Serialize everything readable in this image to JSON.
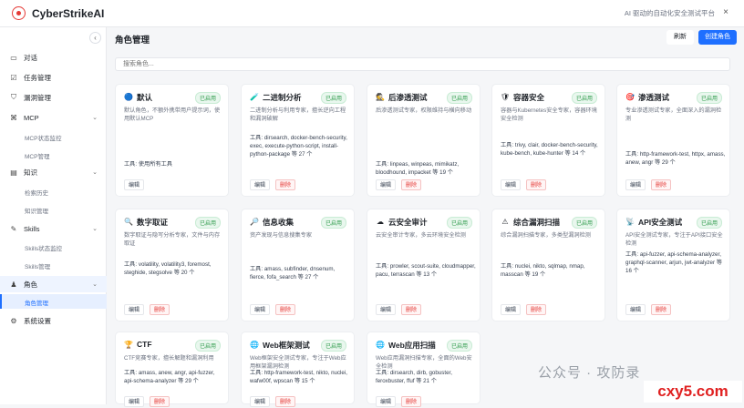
{
  "app": {
    "title": "CyberStrikeAI",
    "tagline": "AI 驱动的自动化安全测试平台",
    "close": "×"
  },
  "sidebar": {
    "items": [
      {
        "label": "对话",
        "icon": "chat-icon"
      },
      {
        "label": "任务管理",
        "icon": "task-icon"
      },
      {
        "label": "漏洞管理",
        "icon": "shield-icon"
      },
      {
        "label": "MCP",
        "icon": "mcp-icon",
        "subs": [
          "MCP状态监控",
          "MCP管理"
        ]
      },
      {
        "label": "知识",
        "icon": "knowledge-icon",
        "subs": [
          "检索历史",
          "知识管理"
        ]
      },
      {
        "label": "Skills",
        "icon": "skills-icon",
        "subs": [
          "Skills状态监控",
          "Skills管理"
        ]
      },
      {
        "label": "角色",
        "icon": "role-icon",
        "subs": [
          "角色管理"
        ]
      },
      {
        "label": "系统设置",
        "icon": "gear-icon"
      }
    ]
  },
  "main": {
    "title": "角色管理",
    "refresh": "刷新",
    "create": "创建角色",
    "search_placeholder": "搜索角色..."
  },
  "labels": {
    "enabled": "已启用",
    "edit": "编辑",
    "delete": "删除",
    "tools_prefix": "工具:"
  },
  "cards": [
    {
      "icon": "🔵",
      "title": "默认",
      "desc": "默认角色，不额外携带用户提示词，使用默认MCP",
      "tools": "使用所有工具",
      "deletable": false
    },
    {
      "icon": "🧪",
      "title": "二进制分析",
      "desc": "二进制分析与利用专家，擅长逆向工程和漏洞破解",
      "tools": "dirsearch, docker-bench-security, exec, execute-python-script, install-python-package 等 27 个",
      "deletable": true
    },
    {
      "icon": "🕵",
      "title": "后渗透测试",
      "desc": "后渗透测试专家，权限维持与横向移动",
      "tools": "linpeas, winpeas, mimikatz, bloodhound, impacket 等 19 个",
      "deletable": true
    },
    {
      "icon": "🛡",
      "title": "容器安全",
      "desc": "容器与Kubernetes安全专家，容器环境安全检测",
      "tools": "trivy, clair, docker-bench-security, kube-bench, kube-hunter 等 14 个",
      "deletable": true
    },
    {
      "icon": "🎯",
      "title": "渗透测试",
      "desc": "专业渗透测试专家，全面深入的漏洞检测",
      "tools": "http-framework-test, httpx, amass, anew, angr 等 29 个",
      "deletable": true
    },
    {
      "icon": "🔍",
      "title": "数字取证",
      "desc": "数字取证与隐写分析专家，文件与内存取证",
      "tools": "volatility, volatility3, foremost, steghide, stegsolve 等 20 个",
      "deletable": true
    },
    {
      "icon": "🔎",
      "title": "信息收集",
      "desc": "资产发现与信息搜集专家",
      "tools": "amass, subfinder, dnsenum, fierce, fofa_search 等 27 个",
      "deletable": true
    },
    {
      "icon": "☁",
      "title": "云安全审计",
      "desc": "云安全审计专家，多云环境安全检测",
      "tools": "prowler, scout-suite, cloudmapper, pacu, terrascan 等 13 个",
      "deletable": true
    },
    {
      "icon": "⚠",
      "title": "综合漏洞扫描",
      "desc": "综合漏洞扫描专家，多类型漏洞检测",
      "tools": "nuclei, nikto, sqlmap, nmap, masscan 等 19 个",
      "deletable": true
    },
    {
      "icon": "📡",
      "title": "API安全测试",
      "desc": "API安全测试专家，专注于API接口安全检测",
      "tools": "api-fuzzer, api-schema-analyzer, graphql-scanner, arjun, jwt-analyzer 等 16 个",
      "deletable": true
    },
    {
      "icon": "🏆",
      "title": "CTF",
      "desc": "CTF竞赛专家，擅长解题和漏洞利用",
      "tools": "amass, anew, angr, api-fuzzer, api-schema-analyzer 等 29 个",
      "deletable": true
    },
    {
      "icon": "🌐",
      "title": "Web框架测试",
      "desc": "Web框架安全测试专家，专注于Web应用框架漏洞检测",
      "tools": "http-framework-test, nikto, nuclei, wafw00f, wpscan 等 15 个",
      "deletable": true
    },
    {
      "icon": "🌐",
      "title": "Web应用扫描",
      "desc": "Web应用漏洞扫描专家，全面的Web安全检测",
      "tools": "dirsearch, dirb, gobuster, feroxbuster, ffuf 等 21 个",
      "deletable": true
    }
  ],
  "watermark": {
    "text": "公众号 · 攻防录",
    "site": "cxy5.com"
  }
}
